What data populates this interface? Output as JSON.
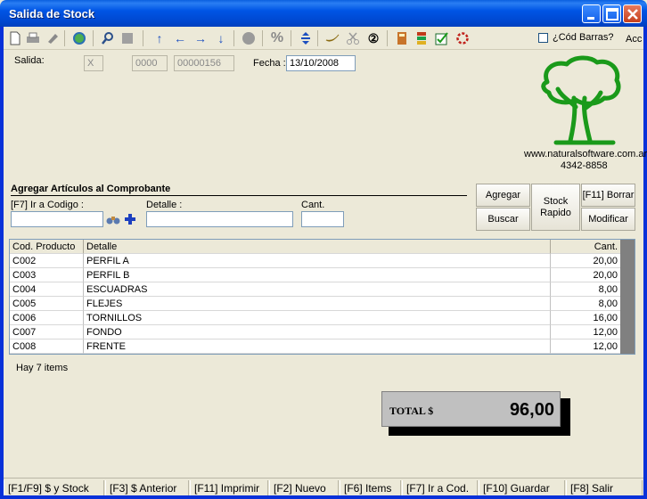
{
  "window": {
    "title": "Salida de Stock"
  },
  "toolbar": {
    "icons": [
      "new-doc-icon",
      "print-icon",
      "brush-icon",
      "refresh-icon",
      "search-icon",
      "stop-icon",
      "arrow-up-icon",
      "arrow-left-icon",
      "arrow-right-icon",
      "arrow-down-icon",
      "record-icon",
      "percent-icon",
      "expand-vertical-icon",
      "banana-icon",
      "scissors-icon",
      "circled-2-icon",
      "book-icon",
      "stack-icon",
      "checkbox-icon",
      "ring-icon"
    ],
    "arrows": {
      "up": "↑",
      "left": "←",
      "right": "→",
      "down": "↓"
    },
    "percent": "%",
    "circled_two": "②",
    "cod_barras_label": "¿Cód Barras?",
    "acc_label": "Acc"
  },
  "header": {
    "salida_label": "Salida:",
    "salida_value": "X",
    "serie_value": "0000",
    "numero_value": "00000156",
    "fecha_label": "Fecha :",
    "fecha_value": "13/10/2008"
  },
  "company": {
    "website": "www.naturalsoftware.com.ar",
    "phone": "4342-8858",
    "logo_color": "#1a9a1a"
  },
  "add_section": {
    "title": "Agregar Artículos al Comprobante",
    "codigo_label": "[F7] Ir a Codigo :",
    "detalle_label": "Detalle :",
    "cant_label": "Cant.",
    "codigo_value": "",
    "detalle_value": "",
    "cant_value": "",
    "buttons": {
      "agregar": "Agregar",
      "buscar": "Buscar",
      "stock_rapido": "Stock Rapido",
      "borrar": "[F11] Borrar",
      "modificar": "Modificar"
    }
  },
  "grid": {
    "columns": [
      "Cod. Producto",
      "Detalle",
      "Cant."
    ],
    "rows": [
      {
        "code": "C002",
        "detail": "PERFIL A",
        "qty": "20,00"
      },
      {
        "code": "C003",
        "detail": "PERFIL B",
        "qty": "20,00"
      },
      {
        "code": "C004",
        "detail": "ESCUADRAS",
        "qty": "8,00"
      },
      {
        "code": "C005",
        "detail": "FLEJES",
        "qty": "8,00"
      },
      {
        "code": "C006",
        "detail": "TORNILLOS",
        "qty": "16,00"
      },
      {
        "code": "C007",
        "detail": "FONDO",
        "qty": "12,00"
      },
      {
        "code": "C008",
        "detail": "FRENTE",
        "qty": "12,00"
      }
    ]
  },
  "items_count": "Hay 7 items",
  "total": {
    "label": "TOTAL $",
    "value": "96,00"
  },
  "statusbar": {
    "items": [
      "[F1/F9] $ y Stock",
      "[F3] $ Anterior",
      "[F11] Imprimir",
      "[F2] Nuevo",
      "[F6] Items",
      "[F7] Ir a Cod.",
      "[F10] Guardar",
      "[F8] Salir"
    ]
  },
  "colors": {
    "titlebar": "#0055e5",
    "window_bg": "#ece9d8",
    "accent": "#1c4fbf"
  }
}
